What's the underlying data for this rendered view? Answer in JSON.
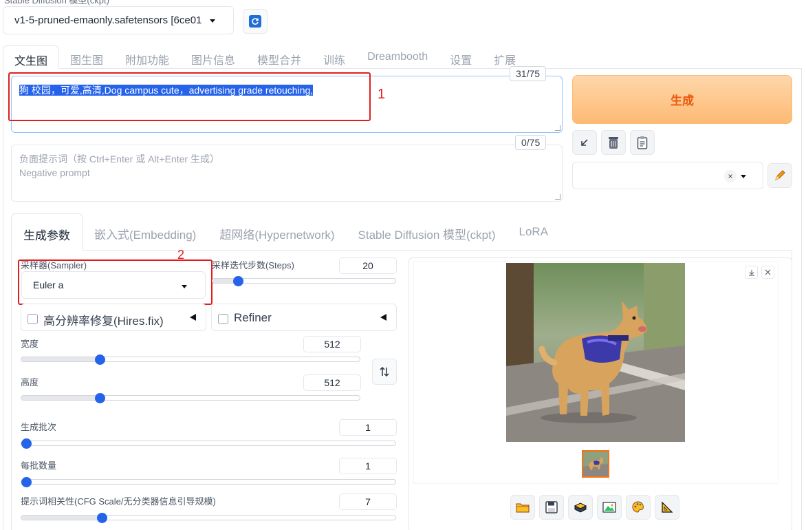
{
  "model": {
    "label": "Stable Diffusion 模型(ckpt)",
    "selected": "v1-5-pruned-emaonly.safetensors [6ce01"
  },
  "tabs": [
    "文生图",
    "图生图",
    "附加功能",
    "图片信息",
    "模型合并",
    "训练",
    "Dreambooth",
    "设置",
    "扩展"
  ],
  "prompt": {
    "text": "狗 校园，可爱,高清,Dog campus cute，advertising grade retouching,",
    "counter": "31/75"
  },
  "negative_prompt": {
    "placeholder_line1": "负面提示词（按 Ctrl+Enter 或 Alt+Enter 生成）",
    "placeholder_line2": "Negative prompt",
    "counter": "0/75"
  },
  "generate_label": "生成",
  "annotations": [
    "1",
    "2"
  ],
  "subtabs": [
    "生成参数",
    "嵌入式(Embedding)",
    "超网络(Hypernetwork)",
    "Stable Diffusion 模型(ckpt)",
    "LoRA"
  ],
  "params": {
    "sampler_label": "采样器(Sampler)",
    "sampler_value": "Euler a",
    "steps_label": "采样迭代步数(Steps)",
    "steps_value": "20",
    "hires_label": "高分辨率修复(Hires.fix)",
    "refiner_label": "Refiner",
    "width_label": "宽度",
    "width_value": "512",
    "height_label": "高度",
    "height_value": "512",
    "batch_count_label": "生成批次",
    "batch_count_value": "1",
    "batch_size_label": "每批数量",
    "batch_size_value": "1",
    "cfg_label": "提示词相关性(CFG Scale/无分类器信息引导规模)",
    "cfg_value": "7"
  },
  "icons": {
    "refresh": "refresh-icon",
    "read_params": "arrow-down-left-icon",
    "trash": "trash-icon",
    "paste": "clipboard-icon",
    "edit_style": "pencil-icon",
    "swap": "swap-icon",
    "download": "download-icon",
    "close": "close-icon",
    "folder": "folder-icon",
    "save": "save-icon",
    "zip": "zip-icon",
    "image": "image-icon",
    "palette": "palette-icon",
    "ruler": "ruler-icon"
  },
  "colors": {
    "accent": "#2563eb",
    "generate_bg": "#fdba74",
    "generate_text": "#ea580c",
    "annotation_red": "#e11d1d"
  }
}
